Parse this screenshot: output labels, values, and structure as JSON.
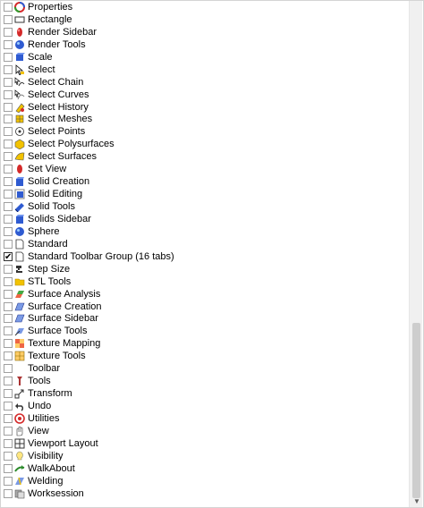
{
  "toolbars": [
    {
      "label": "Properties",
      "checked": false,
      "icon": "properties-icon"
    },
    {
      "label": "Rectangle",
      "checked": false,
      "icon": "rectangle-icon"
    },
    {
      "label": "Render Sidebar",
      "checked": false,
      "icon": "render-sidebar-icon"
    },
    {
      "label": "Render Tools",
      "checked": false,
      "icon": "render-tools-icon"
    },
    {
      "label": "Scale",
      "checked": false,
      "icon": "scale-icon"
    },
    {
      "label": "Select",
      "checked": false,
      "icon": "select-icon"
    },
    {
      "label": "Select Chain",
      "checked": false,
      "icon": "select-chain-icon"
    },
    {
      "label": "Select Curves",
      "checked": false,
      "icon": "select-curves-icon"
    },
    {
      "label": "Select History",
      "checked": false,
      "icon": "select-history-icon"
    },
    {
      "label": "Select Meshes",
      "checked": false,
      "icon": "select-meshes-icon"
    },
    {
      "label": "Select Points",
      "checked": false,
      "icon": "select-points-icon"
    },
    {
      "label": "Select Polysurfaces",
      "checked": false,
      "icon": "select-polysurfaces-icon"
    },
    {
      "label": "Select Surfaces",
      "checked": false,
      "icon": "select-surfaces-icon"
    },
    {
      "label": "Set View",
      "checked": false,
      "icon": "set-view-icon"
    },
    {
      "label": "Solid Creation",
      "checked": false,
      "icon": "solid-creation-icon"
    },
    {
      "label": "Solid Editing",
      "checked": false,
      "icon": "solid-editing-icon"
    },
    {
      "label": "Solid Tools",
      "checked": false,
      "icon": "solid-tools-icon"
    },
    {
      "label": "Solids Sidebar",
      "checked": false,
      "icon": "solids-sidebar-icon"
    },
    {
      "label": "Sphere",
      "checked": false,
      "icon": "sphere-icon"
    },
    {
      "label": "Standard",
      "checked": false,
      "icon": "document-icon"
    },
    {
      "label": "Standard Toolbar Group (16 tabs)",
      "checked": true,
      "icon": "document-icon"
    },
    {
      "label": "Step Size",
      "checked": false,
      "icon": "step-size-icon"
    },
    {
      "label": "STL Tools",
      "checked": false,
      "icon": "folder-icon"
    },
    {
      "label": "Surface Analysis",
      "checked": false,
      "icon": "surface-analysis-icon"
    },
    {
      "label": "Surface Creation",
      "checked": false,
      "icon": "surface-creation-icon"
    },
    {
      "label": "Surface Sidebar",
      "checked": false,
      "icon": "surface-sidebar-icon"
    },
    {
      "label": "Surface Tools",
      "checked": false,
      "icon": "surface-tools-icon"
    },
    {
      "label": "Texture Mapping",
      "checked": false,
      "icon": "texture-mapping-icon"
    },
    {
      "label": "Texture Tools",
      "checked": false,
      "icon": "texture-tools-icon"
    },
    {
      "label": "Toolbar",
      "checked": false,
      "icon": "none"
    },
    {
      "label": "Tools",
      "checked": false,
      "icon": "tools-icon"
    },
    {
      "label": "Transform",
      "checked": false,
      "icon": "transform-icon"
    },
    {
      "label": "Undo",
      "checked": false,
      "icon": "undo-icon"
    },
    {
      "label": "Utilities",
      "checked": false,
      "icon": "utilities-icon"
    },
    {
      "label": "View",
      "checked": false,
      "icon": "view-icon"
    },
    {
      "label": "Viewport Layout",
      "checked": false,
      "icon": "viewport-layout-icon"
    },
    {
      "label": "Visibility",
      "checked": false,
      "icon": "visibility-icon"
    },
    {
      "label": "WalkAbout",
      "checked": false,
      "icon": "walkabout-icon"
    },
    {
      "label": "Welding",
      "checked": false,
      "icon": "welding-icon"
    },
    {
      "label": "Worksession",
      "checked": false,
      "icon": "worksession-icon"
    }
  ],
  "colors": {
    "blue": "#2f5bd1",
    "red": "#d42a2a",
    "yellow": "#f2c200",
    "gray": "#808080",
    "scroll_thumb": "#cdcdcd"
  }
}
